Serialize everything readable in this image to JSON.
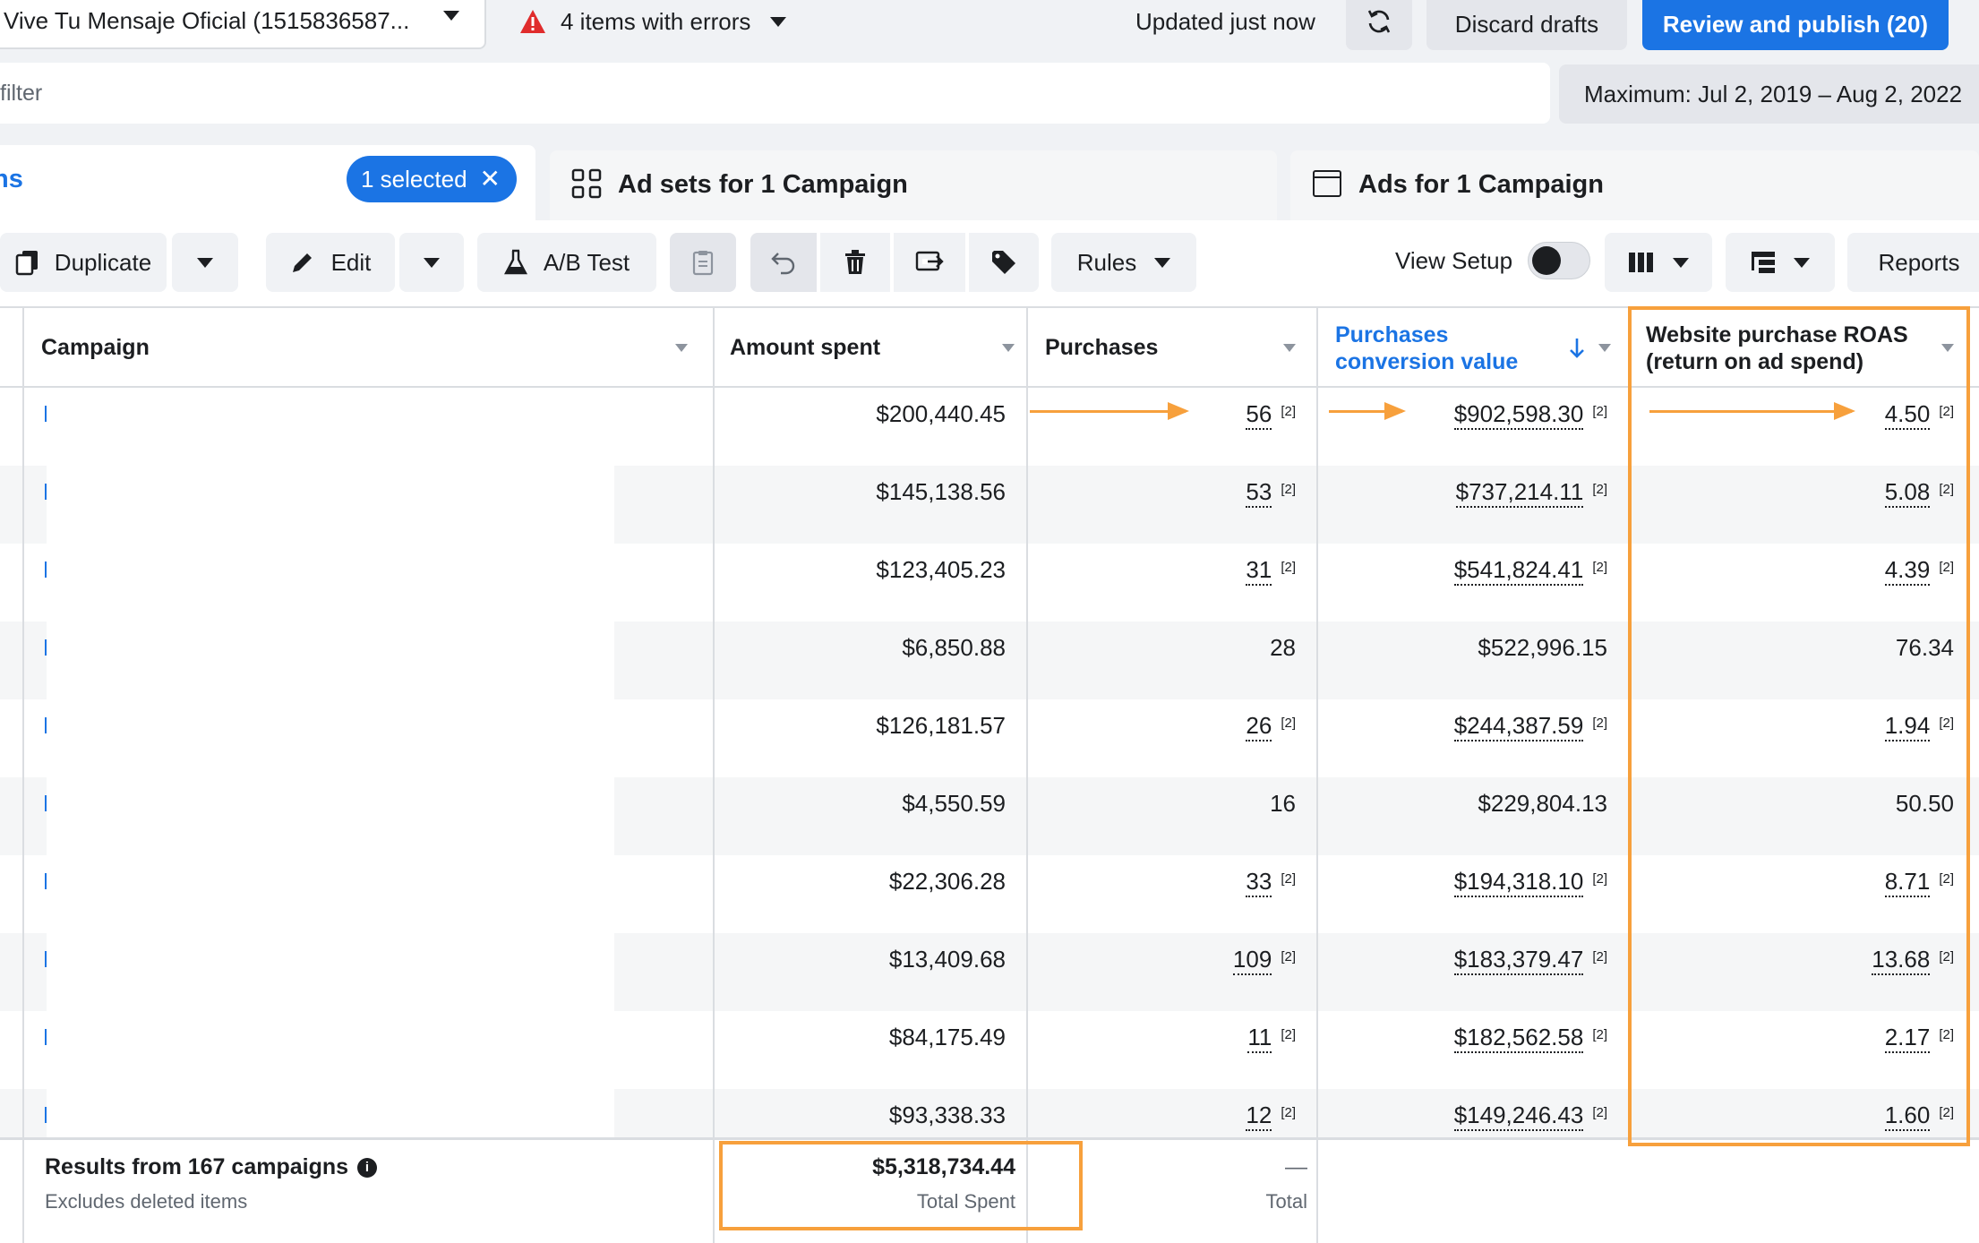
{
  "topbar": {
    "account_name": "Vive Tu Mensaje Oficial (1515836587...",
    "errors_label": "4 items with errors",
    "updated_label": "Updated just now",
    "discard_label": "Discard drafts",
    "publish_label": "Review and publish (20)"
  },
  "filter": {
    "placeholder": "filter",
    "date_range": "Maximum: Jul 2, 2019 – Aug 2, 2022"
  },
  "tabs": {
    "campaigns_label": "ns",
    "selected_label": "1 selected",
    "adsets_label": "Ad sets for 1 Campaign",
    "ads_label": "Ads for 1 Campaign"
  },
  "toolbar": {
    "duplicate_label": "Duplicate",
    "edit_label": "Edit",
    "ab_test_label": "A/B Test",
    "rules_label": "Rules",
    "view_setup_label": "View Setup",
    "reports_label": "Reports"
  },
  "table": {
    "headers": {
      "campaign": "Campaign",
      "amount_spent": "Amount spent",
      "purchases": "Purchases",
      "conversion_value_1": "Purchases",
      "conversion_value_2": "conversion value",
      "roas_1": "Website purchase ROAS",
      "roas_2": "(return on ad spend)"
    },
    "footnote": "[2]",
    "rows": [
      {
        "spent": "$200,440.45",
        "purchases": "56",
        "value": "$902,598.30",
        "roas": "4.50"
      },
      {
        "spent": "$145,138.56",
        "purchases": "53",
        "value": "$737,214.11",
        "roas": "5.08"
      },
      {
        "spent": "$123,405.23",
        "purchases": "31",
        "value": "$541,824.41",
        "roas": "4.39"
      },
      {
        "spent": "$6,850.88",
        "purchases": "28",
        "value": "$522,996.15",
        "roas": "76.34"
      },
      {
        "spent": "$126,181.57",
        "purchases": "26",
        "value": "$244,387.59",
        "roas": "1.94"
      },
      {
        "spent": "$4,550.59",
        "purchases": "16",
        "value": "$229,804.13",
        "roas": "50.50"
      },
      {
        "spent": "$22,306.28",
        "purchases": "33",
        "value": "$194,318.10",
        "roas": "8.71"
      },
      {
        "spent": "$13,409.68",
        "purchases": "109",
        "value": "$183,379.47",
        "roas": "13.68"
      },
      {
        "spent": "$84,175.49",
        "purchases": "11",
        "value": "$182,562.58",
        "roas": "2.17"
      },
      {
        "spent": "$93,338.33",
        "purchases": "12",
        "value": "$149,246.43",
        "roas": "1.60"
      }
    ],
    "footer": {
      "title": "Results from 167 campaigns",
      "subtitle": "Excludes deleted items",
      "total_spent": "$5,318,734.44",
      "total_spent_label": "Total Spent",
      "purchases_total": "—",
      "purchases_total_label": "Total"
    }
  },
  "colors": {
    "accent": "#1b74e4",
    "highlight": "#f7a03c"
  }
}
